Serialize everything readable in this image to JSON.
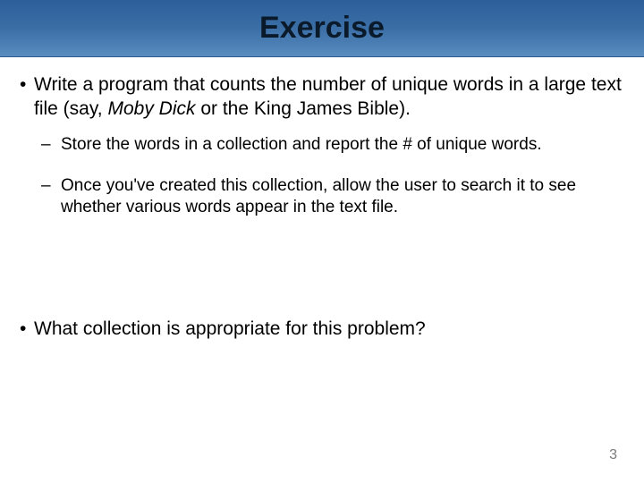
{
  "title": "Exercise",
  "bullets": {
    "b1_pre": "Write a program that counts the number of unique words in a large text file (say, ",
    "b1_italic": "Moby Dick",
    "b1_post": " or the King James Bible).",
    "b2": "Store the words in a collection and report the # of unique words.",
    "b3": "Once you've created this collection, allow the user to search it to see whether various words appear in the text file.",
    "b4": "What collection is appropriate for this problem?"
  },
  "page_number": "3"
}
